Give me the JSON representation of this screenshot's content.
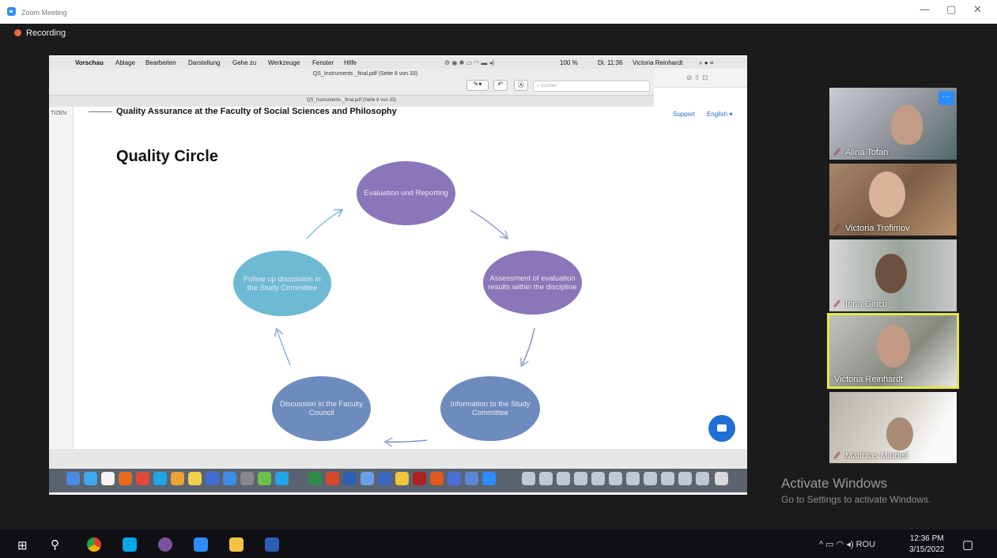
{
  "window": {
    "title": "Zoom Meeting",
    "minimize": "—",
    "restore": "▢",
    "close": "✕"
  },
  "recording": {
    "label": "Recording"
  },
  "mac_menu": {
    "apple": "",
    "app": "Vorschau",
    "items": [
      "Ablage",
      "Bearbeiten",
      "Darstellung",
      "Gehe zu",
      "Werkzeuge",
      "Fenster",
      "Hilfe"
    ],
    "status": "100 %",
    "time": "Di. 11:36",
    "user": "Victoria Reinhardt"
  },
  "preview": {
    "doc_title": "QS_Instruments _final.pdf (Seite 8 von 33)",
    "sub_title": "QS_Instruments _final.pdf (Seite 8 von 33)",
    "search_placeholder": "Suchen",
    "left_label": "TIZEN"
  },
  "slide": {
    "header": "Quality Assurance at the Faculty of Social Sciences and Philosophy",
    "title": "Quality Circle",
    "nodes": {
      "evaluation": "Evaluation und Reporting",
      "assessment": "Assessment of evaluation results within the discipline",
      "information": "Information to the Study Committee",
      "discussion": "Discussion in the Faculty Council",
      "followup": "Follow up discussion in the Study Committee"
    }
  },
  "web_panel": {
    "support": "Support",
    "language": "English ▾"
  },
  "participants": [
    {
      "name": "Alina Tofan",
      "muted": true
    },
    {
      "name": "Victoria Trofimov",
      "muted": true
    },
    {
      "name": "Irina Gincu",
      "muted": true
    },
    {
      "name": "Victoria Reinhardt",
      "muted": false,
      "active": true
    },
    {
      "name": "Matthias Middell",
      "muted": true
    }
  ],
  "more_button": "···",
  "activate": {
    "title": "Activate Windows",
    "subtitle": "Go to Settings to activate Windows."
  },
  "taskbar": {
    "language": "ROU",
    "time": "12:36 PM",
    "date": "3/15/2022"
  },
  "colors": {
    "zoom_blue": "#2d8cff",
    "active_border": "#e6e64a",
    "node_purple": "#8a76b8",
    "node_blue": "#6d8cbd",
    "node_teal": "#6ebad4"
  }
}
